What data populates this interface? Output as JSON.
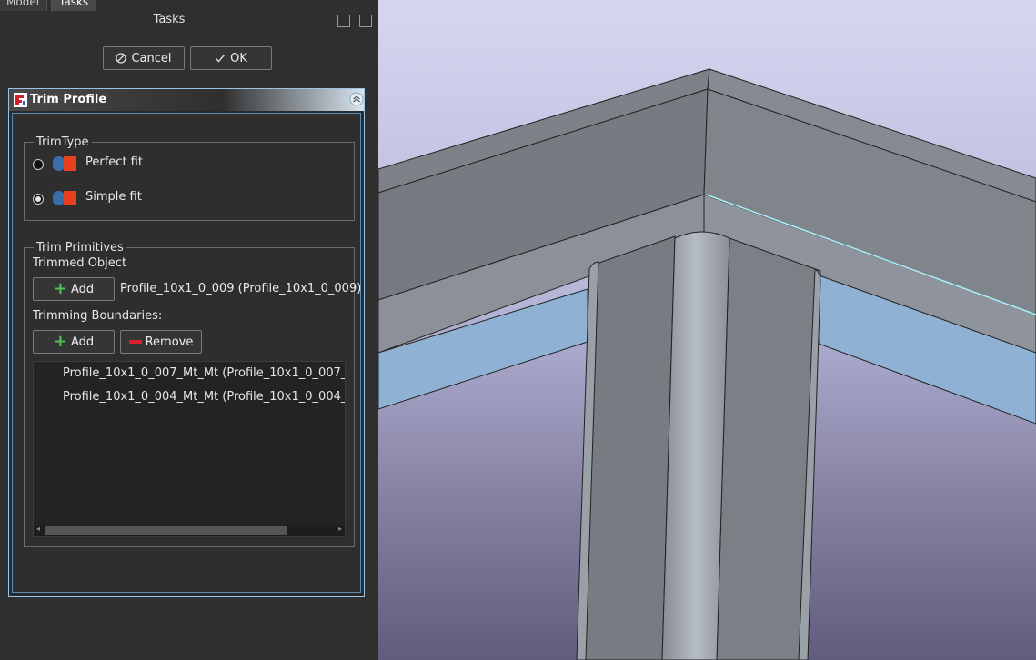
{
  "tabs": [
    {
      "label": "Model"
    },
    {
      "label": "Tasks"
    }
  ],
  "tasks_title": "Tasks",
  "buttons": {
    "cancel": "Cancel",
    "ok": "OK"
  },
  "panel": {
    "title": "Trim Profile",
    "trim_type": {
      "legend": "TrimType",
      "options": [
        {
          "label": "Perfect fit",
          "selected": false
        },
        {
          "label": "Simple fit",
          "selected": true
        }
      ]
    },
    "primitives": {
      "legend": "Trim Primitives",
      "trimmed_object_label": "Trimmed Object",
      "add_label": "Add",
      "trimmed_object_value": "Profile_10x1_0_009 (Profile_10x1_0_009)",
      "boundaries_label": "Trimming Boundaries:",
      "add2_label": "Add",
      "remove_label": "Remove",
      "boundaries": [
        "Profile_10x1_0_007_Mt_Mt (Profile_10x1_0_007_Mt_",
        "Profile_10x1_0_004_Mt_Mt (Profile_10x1_0_004_Mt_"
      ]
    }
  },
  "colors": {
    "accent": "#9ac4e6",
    "trim_blue": "#3a6ea8",
    "trim_red": "#e8401f",
    "edge_highlight": "#a8f4ff"
  }
}
